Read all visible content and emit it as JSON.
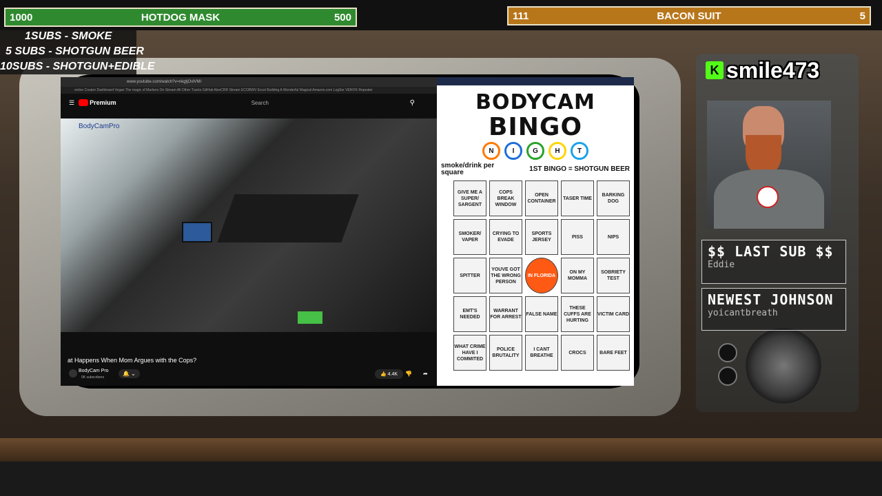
{
  "goals": {
    "left": {
      "current": "1000",
      "name": "HOTDOG MASK",
      "target": "500",
      "color": "#2f8a2f"
    },
    "right": {
      "current": "111",
      "name": "BACON SUIT",
      "target": "5",
      "color": "#b8761a"
    }
  },
  "rules": [
    "1SUBS   - SMOKE",
    "5 SUBS  - SHOTGUN BEER",
    "10SUBS - SHOTGUN+EDIBLE"
  ],
  "browser": {
    "url": "www.youtube.com/watch?v=nkgtjOvlVMI",
    "bookmarks": "ective   Creator Dashboard   Vegan The magic of   Markers On Stream   All Other Tracks   GitHub   AlexCRR Stream   ECORWV Excel Building   A Wonderful Magical   Amazon.com LogSer   VEIKFK Repeater",
    "premium_label": "Premium",
    "search_placeholder": "Search",
    "watermark": "BodyCamPro"
  },
  "video": {
    "title": "at Happens When Mom Argues with the Cops?",
    "channel": "BodyCam Pro",
    "subscribers": "0K subscribers",
    "likes": "4.4K"
  },
  "bingo": {
    "title_line1": "BODYCAM",
    "title_line2": "BINGO",
    "night_letters": [
      "N",
      "I",
      "G",
      "H",
      "T"
    ],
    "night_colors": [
      "#ff7a00",
      "#1e6fd9",
      "#29a329",
      "#ffd400",
      "#1aa3e8"
    ],
    "rule_left": "smoke/drink per square",
    "rule_right": "1ST BINGO = SHOTGUN BEER",
    "cells": [
      "GIVE ME A SUPER/ SARGENT",
      "COPS BREAK WINDOW",
      "OPEN CONTAINER",
      "TASER TIME",
      "BARKING DOG",
      "SMOKER/ VAPER",
      "CRYING TO EVADE",
      "SPORTS JERSEY",
      "PISS",
      "NIPS",
      "SPITTER",
      "YOUVE GOT THE WRONG PERSON",
      "IN FLORIDA",
      "ON MY MOMMA",
      "SOBRIETY TEST",
      "EMT'S NEEDED",
      "WARRANT FOR ARREST",
      "FALSE NAME",
      "THESE CUFFS ARE HURTING",
      "VICTIM CARD",
      "WHAT CRIME HAVE I COMMITED",
      "POLICE BRUTALITY",
      "I CANT BREATHE",
      "CROCS",
      "BARE FEET"
    ]
  },
  "streamer": {
    "name": "smile473",
    "platform_icon": "kick-logo-icon"
  },
  "last_sub": {
    "title": "$$ LAST SUB $$",
    "name": "Eddie"
  },
  "newest": {
    "title": "NEWEST JOHNSON",
    "name": "yoicantbreath"
  }
}
